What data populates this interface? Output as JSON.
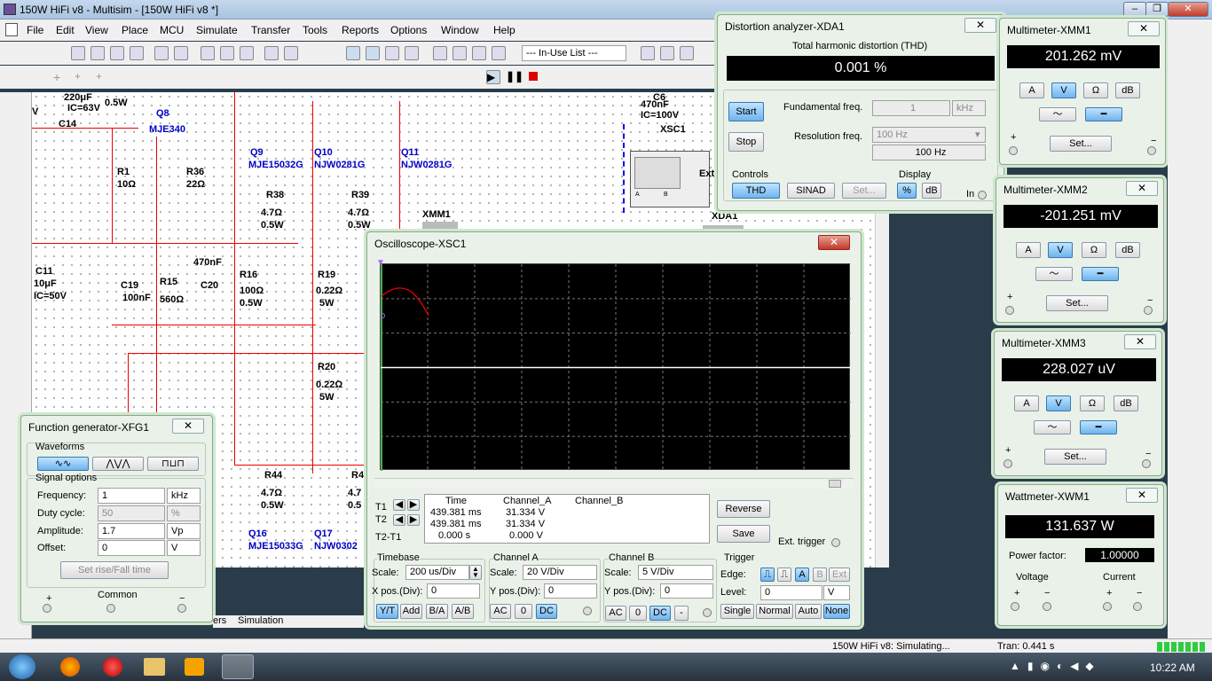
{
  "app": {
    "title": "150W HiFi v8 - Multisim - [150W HiFi v8 *]"
  },
  "menu": [
    "File",
    "Edit",
    "View",
    "Place",
    "MCU",
    "Simulate",
    "Transfer",
    "Tools",
    "Reports",
    "Options",
    "Window",
    "Help"
  ],
  "toolbar": {
    "in_use_list": "--- In-Use List ---"
  },
  "schematic": {
    "labels": [
      {
        "t": "220μF",
        "blue": false
      },
      {
        "t": "IC=63V",
        "blue": false
      },
      {
        "t": "0.5W",
        "blue": false
      },
      {
        "t": "C14",
        "blue": false
      },
      {
        "t": "V",
        "blue": false
      },
      {
        "t": "Q8",
        "blue": true
      },
      {
        "t": "MJE340",
        "blue": true
      },
      {
        "t": "R1",
        "blue": false
      },
      {
        "t": "10Ω",
        "blue": false
      },
      {
        "t": "R36",
        "blue": false
      },
      {
        "t": "22Ω",
        "blue": false
      },
      {
        "t": "Q9",
        "blue": true
      },
      {
        "t": "MJE15032G",
        "blue": true
      },
      {
        "t": "Q10",
        "blue": true
      },
      {
        "t": "NJW0281G",
        "blue": true
      },
      {
        "t": "Q11",
        "blue": true
      },
      {
        "t": "NJW0281G",
        "blue": true
      },
      {
        "t": "R38",
        "blue": false
      },
      {
        "t": "4.7Ω",
        "blue": false
      },
      {
        "t": "0.5W",
        "blue": false
      },
      {
        "t": "R39",
        "blue": false
      },
      {
        "t": "4.7Ω",
        "blue": false
      },
      {
        "t": "0.5W",
        "blue": false
      },
      {
        "t": "XMM1",
        "blue": false
      },
      {
        "t": "C11",
        "blue": false
      },
      {
        "t": "10μF",
        "blue": false
      },
      {
        "t": "IC=50V",
        "blue": false
      },
      {
        "t": "C19",
        "blue": false
      },
      {
        "t": "100nF",
        "blue": false
      },
      {
        "t": "R15",
        "blue": false
      },
      {
        "t": "560Ω",
        "blue": false
      },
      {
        "t": "470nF",
        "blue": false
      },
      {
        "t": "C20",
        "blue": false
      },
      {
        "t": "R16",
        "blue": false
      },
      {
        "t": "100Ω",
        "blue": false
      },
      {
        "t": "0.5W",
        "blue": false
      },
      {
        "t": "R19",
        "blue": false
      },
      {
        "t": "0.22Ω",
        "blue": false
      },
      {
        "t": "5W",
        "blue": false
      },
      {
        "t": "R20",
        "blue": false
      },
      {
        "t": "0.22Ω",
        "blue": false
      },
      {
        "t": "5W",
        "blue": false
      },
      {
        "t": "R44",
        "blue": false
      },
      {
        "t": "4.7Ω",
        "blue": false
      },
      {
        "t": "0.5W",
        "blue": false
      },
      {
        "t": "R4",
        "blue": false
      },
      {
        "t": "4.7",
        "blue": false
      },
      {
        "t": "0.5",
        "blue": false
      },
      {
        "t": "Q16",
        "blue": true
      },
      {
        "t": "MJE15033G",
        "blue": true
      },
      {
        "t": "Q17",
        "blue": true
      },
      {
        "t": "NJW0302",
        "blue": true
      },
      {
        "t": "C6",
        "blue": false
      },
      {
        "t": "470nF",
        "blue": false
      },
      {
        "t": "IC=100V",
        "blue": false
      },
      {
        "t": "XSC1",
        "blue": false
      },
      {
        "t": "XDA1",
        "blue": false
      },
      {
        "t": "Ext Trig",
        "blue": false
      },
      {
        "t": "A",
        "blue": false
      },
      {
        "t": "B",
        "blue": false
      }
    ]
  },
  "distortion": {
    "title": "Distortion analyzer-XDA1",
    "close": "✕",
    "thd_caption": "Total harmonic distortion (THD)",
    "value": "0.001 %",
    "start": "Start",
    "stop": "Stop",
    "fund_label": "Fundamental freq.",
    "fund_value": "1",
    "fund_unit": "kHz",
    "res_label": "Resolution freq.",
    "res_value": "100 Hz",
    "res_readout": "100 Hz",
    "controls_label": "Controls",
    "thd_btn": "THD",
    "sinad_btn": "SINAD",
    "set_btn": "Set...",
    "display_label": "Display",
    "pct_btn": "%",
    "db_btn": "dB",
    "in_label": "In"
  },
  "multimeters": [
    {
      "title": "Multimeter-XMM1",
      "value": "201.262 mV"
    },
    {
      "title": "Multimeter-XMM2",
      "value": "-201.251 mV"
    },
    {
      "title": "Multimeter-XMM3",
      "value": "228.027 uV"
    }
  ],
  "mm_labels": {
    "a": "A",
    "v": "V",
    "ohm": "Ω",
    "db": "dB",
    "set": "Set...",
    "plus": "+",
    "minus": "−",
    "close": "✕"
  },
  "wattmeter": {
    "title": "Wattmeter-XWM1",
    "value": "131.637 W",
    "pf_label": "Power factor:",
    "pf_value": "1.00000",
    "voltage": "Voltage",
    "current": "Current",
    "plus": "+",
    "minus": "−",
    "close": "✕"
  },
  "oscilloscope": {
    "title": "Oscilloscope-XSC1",
    "close": "✕",
    "t1": "T1",
    "t2": "T2",
    "t21": "T2-T1",
    "col_time": "Time",
    "col_a": "Channel_A",
    "col_b": "Channel_B",
    "r1_time": "439.381 ms",
    "r1_a": "31.334 V",
    "r2_time": "439.381 ms",
    "r2_a": "31.334 V",
    "r3_time": "0.000 s",
    "r3_a": "0.000 V",
    "reverse": "Reverse",
    "save": "Save",
    "ext_trigger": "Ext. trigger",
    "timebase": "Timebase",
    "scale_lbl": "Scale:",
    "timebase_scale": "200 us/Div",
    "xpos_lbl": "X pos.(Div):",
    "xpos": "0",
    "yt": "Y/T",
    "add": "Add",
    "ba": "B/A",
    "ab": "A/B",
    "cha": "Channel A",
    "cha_scale": "20  V/Div",
    "ypos_lbl": "Y pos.(Div):",
    "cha_ypos": "0",
    "chb": "Channel B",
    "chb_scale": "5  V/Div",
    "chb_ypos": "0",
    "ac": "AC",
    "zero": "0",
    "dc": "DC",
    "dash": "-",
    "trigger": "Trigger",
    "edge_lbl": "Edge:",
    "level_lbl": "Level:",
    "level": "0",
    "level_unit": "V",
    "trig_a": "A",
    "trig_b": "B",
    "trig_ext": "Ext",
    "single": "Single",
    "normal": "Normal",
    "auto": "Auto",
    "none": "None"
  },
  "funcgen": {
    "title": "Function generator-XFG1",
    "close": "✕",
    "waveforms": "Waveforms",
    "signal_options": "Signal options",
    "freq_lbl": "Frequency:",
    "freq": "1",
    "freq_unit": "kHz",
    "duty_lbl": "Duty cycle:",
    "duty": "50",
    "duty_unit": "%",
    "amp_lbl": "Amplitude:",
    "amp": "1.7",
    "amp_unit": "Vp",
    "off_lbl": "Offset:",
    "off": "0",
    "off_unit": "V",
    "rise_btn": "Set rise/Fall time",
    "common": "Common",
    "plus": "+",
    "minus": "−"
  },
  "status": {
    "sim": "150W HiFi v8: Simulating...",
    "tran": "Tran: 0.441 s",
    "tabs": "ers",
    "sim_tab": "Simulation"
  },
  "taskbar": {
    "time": "10:22 AM"
  }
}
